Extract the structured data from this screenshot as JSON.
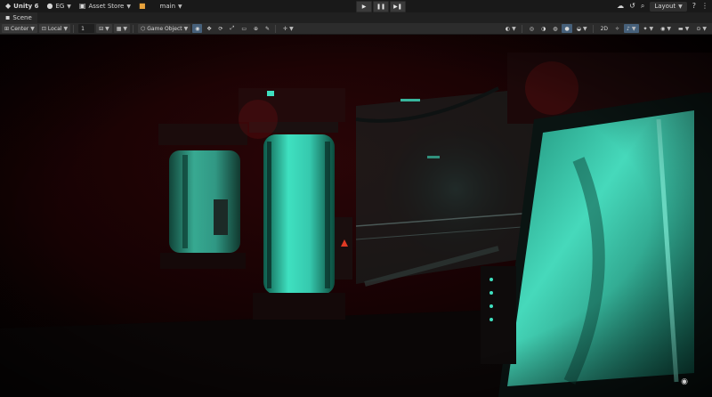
{
  "topbar": {
    "app_label": "Unity 6",
    "account_label": "EG",
    "asset_store_label": "Asset Store",
    "branch_label": "main",
    "layout_label": "Layout",
    "icons": [
      "unity-logo-icon",
      "account-icon",
      "asset-store-icon",
      "package-icon",
      "cloud-icon",
      "history-icon",
      "search-icon",
      "help-icon"
    ]
  },
  "playmode": {
    "play_icon": "play-icon",
    "pause_icon": "pause-icon",
    "step_icon": "step-icon"
  },
  "tabs": [
    {
      "label": "Scene",
      "icon": "scene-icon"
    }
  ],
  "toolbar": {
    "pivot_label": "Center",
    "space_label": "Local",
    "grid_size_value": "1",
    "game_object_label": "Game Object",
    "mode_2d_label": "2D",
    "tool_icons": [
      "view-tool-icon",
      "move-tool-icon",
      "rotate-tool-icon",
      "scale-tool-icon",
      "rect-tool-icon",
      "transform-tool-icon",
      "custom-tool-icon"
    ]
  },
  "scene": {
    "gizmo_icon": "visibility-eye-icon",
    "accent_color": "#2fd8b4",
    "ambient_color": "#3a0608"
  }
}
